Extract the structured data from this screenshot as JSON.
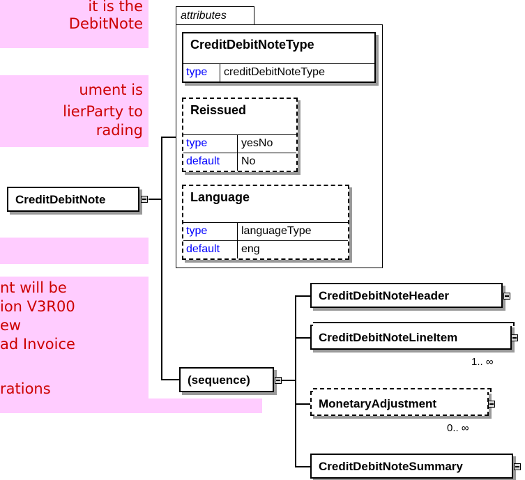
{
  "notes": {
    "n1": [
      "it is the",
      "DebitNote"
    ],
    "n2": [
      "ument is",
      "lierParty to",
      "rading"
    ],
    "n4": [
      "nt will be",
      "ion V3R00",
      "ew",
      "ad Invoice",
      "",
      "rations"
    ]
  },
  "root": {
    "name": "CreditDebitNote"
  },
  "attributes": {
    "label": "attributes",
    "items": [
      {
        "name": "CreditDebitNoteType",
        "rows": [
          {
            "key": "type",
            "value": "creditDebitNoteType"
          }
        ]
      },
      {
        "name": "Reissued",
        "rows": [
          {
            "key": "type",
            "value": "yesNo"
          },
          {
            "key": "default",
            "value": "No"
          }
        ]
      },
      {
        "name": "Language",
        "rows": [
          {
            "key": "type",
            "value": "languageType"
          },
          {
            "key": "default",
            "value": "eng"
          }
        ]
      }
    ]
  },
  "sequence": {
    "label": "(sequence)"
  },
  "children": [
    {
      "name": "CreditDebitNoteHeader",
      "cardinality": ""
    },
    {
      "name": "CreditDebitNoteLineItem",
      "cardinality": "1.. ∞"
    },
    {
      "name": "MonetaryAdjustment",
      "cardinality": "0.. ∞"
    },
    {
      "name": "CreditDebitNoteSummary",
      "cardinality": ""
    }
  ],
  "colors": {
    "note_bg": "#ffccff",
    "note_text": "#cc0000",
    "type_key": "#0000ff",
    "connector": "#d6d6d6"
  }
}
